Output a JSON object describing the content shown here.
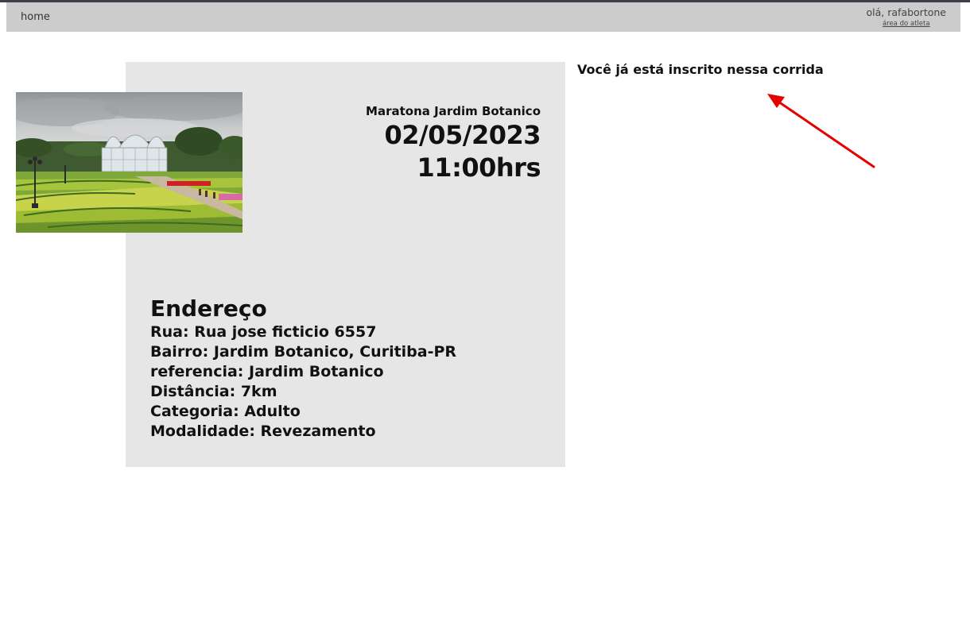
{
  "navbar": {
    "home_label": "home",
    "greeting": "olá, rafabortone",
    "athlete_area_label": "área do atleta"
  },
  "race": {
    "name": "Maratona Jardim Botanico",
    "date": "02/05/2023",
    "time": "11:00hrs",
    "photo_icon": "jardim-botanico-greenhouse-photo"
  },
  "address": {
    "title": "Endereço",
    "street": "Rua: Rua jose ficticio 6557",
    "district": "Bairro: Jardim Botanico, Curitiba-PR",
    "reference": "referencia: Jardim Botanico",
    "distance": "Distância: 7km",
    "category": "Categoria: Adulto",
    "modality": "Modalidade: Revezamento"
  },
  "status": {
    "enrolled_message": "Você já está inscrito nessa corrida"
  },
  "colors": {
    "navbar_bg": "#cccccc",
    "card_bg": "#e6e6e6",
    "annotation_arrow": "#e60000"
  }
}
